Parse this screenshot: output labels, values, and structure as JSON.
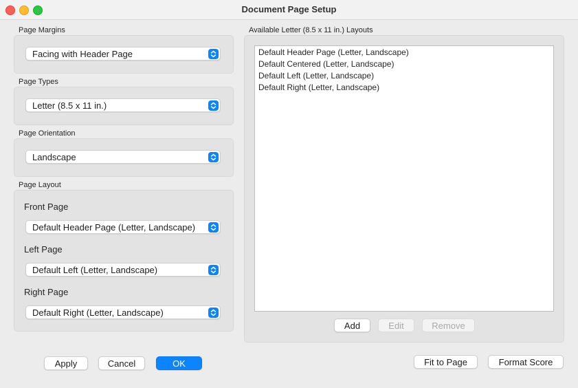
{
  "window": {
    "title": "Document Page Setup"
  },
  "page_margins": {
    "label": "Page Margins",
    "value": "Facing with Header Page"
  },
  "page_types": {
    "label": "Page Types",
    "value": "Letter (8.5 x 11 in.)"
  },
  "page_orientation": {
    "label": "Page Orientation",
    "value": "Landscape"
  },
  "page_layout": {
    "label": "Page Layout",
    "front_label": "Front Page",
    "front_value": "Default Header Page (Letter, Landscape)",
    "left_label": "Left Page",
    "left_value": "Default Left (Letter, Landscape)",
    "right_label": "Right Page",
    "right_value": "Default Right (Letter, Landscape)"
  },
  "layouts": {
    "label": "Available Letter (8.5 x 11 in.) Layouts",
    "items": [
      "Default Header Page (Letter, Landscape)",
      "Default Centered (Letter, Landscape)",
      "Default Left (Letter, Landscape)",
      "Default Right (Letter, Landscape)"
    ],
    "add_label": "Add",
    "edit_label": "Edit",
    "remove_label": "Remove"
  },
  "footer": {
    "apply_label": "Apply",
    "cancel_label": "Cancel",
    "ok_label": "OK",
    "fit_label": "Fit to Page",
    "format_label": "Format Score"
  },
  "colors": {
    "accent": "#0a84ff",
    "close": "#fe5f57",
    "minimize": "#febc2e",
    "maximize": "#28c840"
  }
}
